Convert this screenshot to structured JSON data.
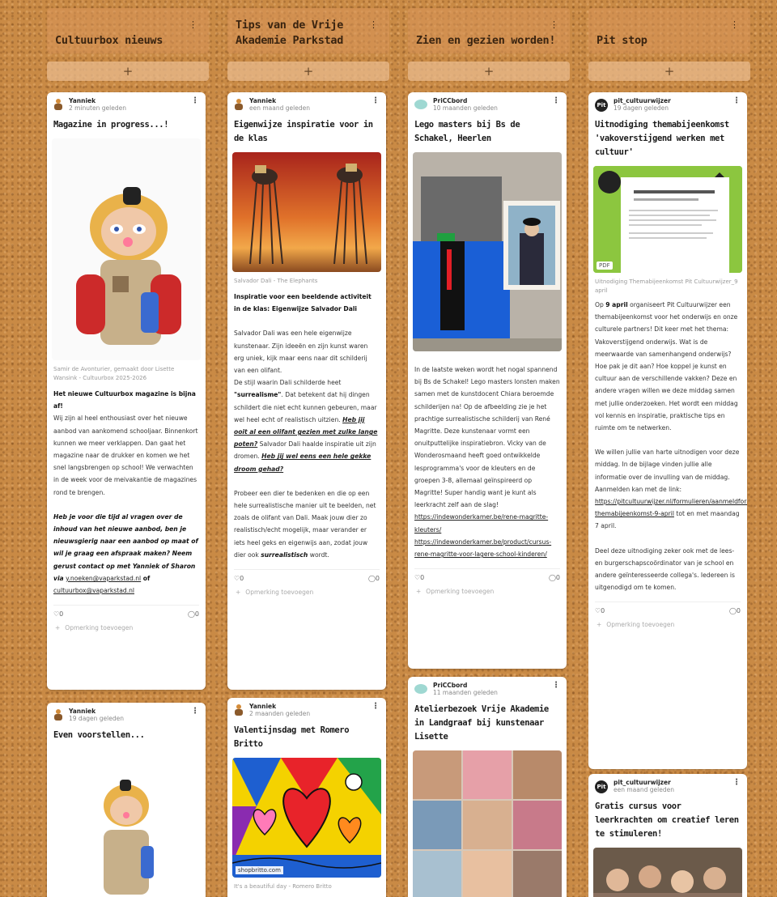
{
  "columns": [
    {
      "title": "Cultuurbox nieuws",
      "add_label": "+",
      "cards": [
        {
          "author": "Yanniek",
          "time": "2 minuten geleden",
          "title": "Magazine in progress...!",
          "caption": "Samir de Avonturier, gemaakt door Lisette Wansink - Cultuurbox 2025-2026",
          "heading": "Het nieuwe Cultuurbox magazine is bijna af!",
          "body1": "Wij zijn al heel enthousiast over het nieuwe aanbod van aankomend schooljaar. Binnenkort kunnen we meer verklappen. Dan gaat het magazine naar de drukker en komen we het snel langsbrengen op school! We verwachten in de week voor de meivakantie de magazines rond te brengen.",
          "body2": "Heb je voor die tijd al vragen over de inhoud van het nieuwe aanbod, ben je nieuwsgierig naar een aanbod op maat of wil je graag een afspraak maken? Neem gerust contact op met Yanniek of Sharon via",
          "link1": "y.noeken@vaparkstad.nl",
          "link_join": " of",
          "link2": "cultuurbox@vaparkstad.nl",
          "likes": "0",
          "comments": "0",
          "comment_add": "Opmerking toevoegen"
        },
        {
          "author": "Yanniek",
          "time": "19 dagen geleden",
          "title": "Even voorstellen..."
        }
      ]
    },
    {
      "title": "Tips van de Vrije Akademie Parkstad",
      "add_label": "+",
      "cards": [
        {
          "author": "Yanniek",
          "time": "een maand geleden",
          "title": "Eigenwijze inspiratie voor in de klas",
          "caption": "Salvador Dali - The Elephants",
          "heading": "Inspiratie voor een beeldende activiteit in de klas: Eigenwijze Salvador Dali",
          "body1": "Salvador Dali was een hele eigenwijze kunstenaar. Zijn ideeën en zijn kunst waren erg uniek, kijk maar eens naar dit schilderij van een olifant.",
          "body2a": "De stijl waarin Dali schilderde heet",
          "body2b": "\"surrealisme\"",
          "body2c": ". Dat betekent dat hij dingen schildert die niet echt kunnen gebeuren, maar wel heel echt of realistisch uitzien.",
          "body2d": "Heb jij ooit al een olifant gezien met zulke lange poten?",
          "body2e": " Salvador Dali haalde inspiratie uit zijn dromen.",
          "body2f": "Heb jij wel eens een hele gekke droom gehad?",
          "body3a": "Probeer een dier te bedenken en die op een hele surrealistische manier uit te beelden, net zoals de olifant van Dali. Maak jouw dier zo realistisch/echt mogelijk, maar verander er iets heel geks en eigenwijs aan, zodat jouw dier ook",
          "body3b": "surrealistisch",
          "body3c": " wordt.",
          "likes": "0",
          "comments": "0",
          "comment_add": "Opmerking toevoegen"
        },
        {
          "author": "Yanniek",
          "time": "2 maanden geleden",
          "title": "Valentijnsdag met Romero Britto",
          "link_tag": "shopbritto.com",
          "caption": "It's a beautiful day - Romero Britto"
        }
      ]
    },
    {
      "title": "Zien en gezien worden!",
      "add_label": "+",
      "cards": [
        {
          "author": "PriCCbord",
          "time": "10 maanden geleden",
          "title": "Lego masters bij Bs de Schakel, Heerlen",
          "body1": "In de laatste weken wordt het nogal spannend bij Bs de Schakel! Lego masters lonsten maken samen met de kunstdocent Chiara beroemde schilderijen na! Op de afbeelding zie je het prachtige surrealistische schilderij van René Magritte. Deze kunstenaar vormt een onuitputtelijke inspiratiebron. Vicky van de Wonderosmaand heeft goed ontwikkelde lesprogramma's voor de kleuters en de groepen 3-8, allemaal geïnspireerd op Magritte! Super handig want je kunt als leerkracht zelf aan de slag!",
          "link1": "https://indewonderkamer.be/rene-magritte-kleuters/",
          "link2": "https://indewonderkamer.be/product/cursus-rene-magritte-voor-lagere-school-kinderen/",
          "likes": "0",
          "comments": "0",
          "comment_add": "Opmerking toevoegen"
        },
        {
          "author": "PriCCbord",
          "time": "11 maanden geleden",
          "title": "Atelierbezoek Vrije Akademie in Landgraaf bij kunstenaar Lisette"
        }
      ]
    },
    {
      "title": "Pit stop",
      "add_label": "+",
      "cards": [
        {
          "author": "pit_cultuurwijzer",
          "time": "19 dagen geleden",
          "title": "Uitnodiging themabijeenkomst 'vakoverstijgend werken met cultuur'",
          "pdf_tag": "PDF",
          "caption": "Uitnodiging Themabijeenkomst Pit Cultuurwijzer_9 april",
          "body1a": "Op",
          "body1b": "9 april",
          "body1c": " organiseert Pit Cultuurwijzer een themabijeenkomst voor het onderwijs en onze culturele partners! Dit keer met het thema: Vakoverstijgend onderwijs. Wat is de meerwaarde van samenhangend onderwijs? Hoe pak je dit aan? Hoe koppel je kunst en cultuur aan de verschillende vakken? Deze en andere vragen willen we deze middag samen met jullie onderzoeken. Het wordt een middag vol kennis en inspiratie, praktische tips en ruimte om te netwerken.",
          "body2": "We willen jullie van harte uitnodigen voor deze middag. In de bijlage vinden jullie alle informatie over de invulling van de middag. Aanmelden kan met de link:",
          "link1": "https://pitcultuurwijzer.nl/formulieren/aanmeldformulier-themabijeenkomst-9-april",
          "body2b": " tot en met maandag 7 april.",
          "body3": "Deel deze uitnodiging zeker ook met de lees- en burgerschapscoördinator van je school en andere geïnteresseerde collega's. Iedereen is uitgenodigd om te komen.",
          "likes": "0",
          "comments": "0",
          "comment_add": "Opmerking toevoegen"
        },
        {
          "author": "pit_cultuurwijzer",
          "time": "een maand geleden",
          "title": "Gratis cursus voor leerkrachten om creatief leren te stimuleren!"
        }
      ]
    }
  ],
  "icons": {
    "more": "⋮",
    "heart": "♡",
    "comment": "◯",
    "plus_small": "+"
  }
}
